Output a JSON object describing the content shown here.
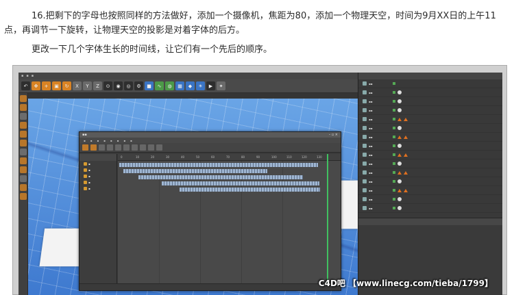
{
  "article": {
    "paragraph_1": "16.把剩下的字母也按照同样的方法做好，添加一个摄像机，焦距为80，添加一个物理天空，时间为9月XX日的上午11点，再调节一下旋转，让物理天空的投影是对着字体的后方。",
    "paragraph_2": "更改一下几个字体生长的时间线，让它们有一个先后的顺序。"
  },
  "screenshot": {
    "watermark": "C4D吧 【www.linecg.com/tieba/1799】",
    "timeline": {
      "ruler_ticks": [
        "0",
        "10",
        "20",
        "30",
        "40",
        "50",
        "60",
        "70",
        "80",
        "90",
        "100",
        "110",
        "120",
        "130"
      ]
    }
  },
  "colors": {
    "accent_orange": "#d98324",
    "viewport_blue": "#4f8ad8",
    "playhead_green": "#40c060"
  }
}
